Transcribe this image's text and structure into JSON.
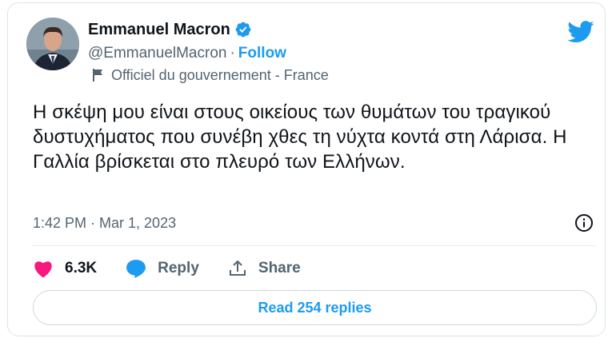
{
  "author": {
    "name": "Emmanuel Macron",
    "handle": "@EmmanuelMacron",
    "separator": "·",
    "follow_label": "Follow",
    "label": "Officiel du gouvernement - France",
    "verified": true
  },
  "tweet": {
    "text": "Η σκέψη μου είναι στους οικείους των θυμάτων του τραγικού δυστυχήματος που συνέβη χθες τη νύχτα κοντά στη Λάρισα. Η Γαλλία βρίσκεται στο πλευρό των Ελλήνων.",
    "timestamp": "1:42 PM · Mar 1, 2023"
  },
  "actions": {
    "likes_count": "6.3K",
    "reply_label": "Reply",
    "share_label": "Share"
  },
  "read_replies_label": "Read 254 replies",
  "colors": {
    "accent": "#1d9bf0",
    "like": "#f91880",
    "text": "#0f1419",
    "muted": "#536471"
  },
  "icons": {
    "verified": "verified-badge-icon",
    "platform": "twitter-bird-icon",
    "label": "flag-icon",
    "info": "info-icon",
    "like": "heart-icon",
    "reply": "speech-bubble-icon",
    "share": "share-icon"
  }
}
